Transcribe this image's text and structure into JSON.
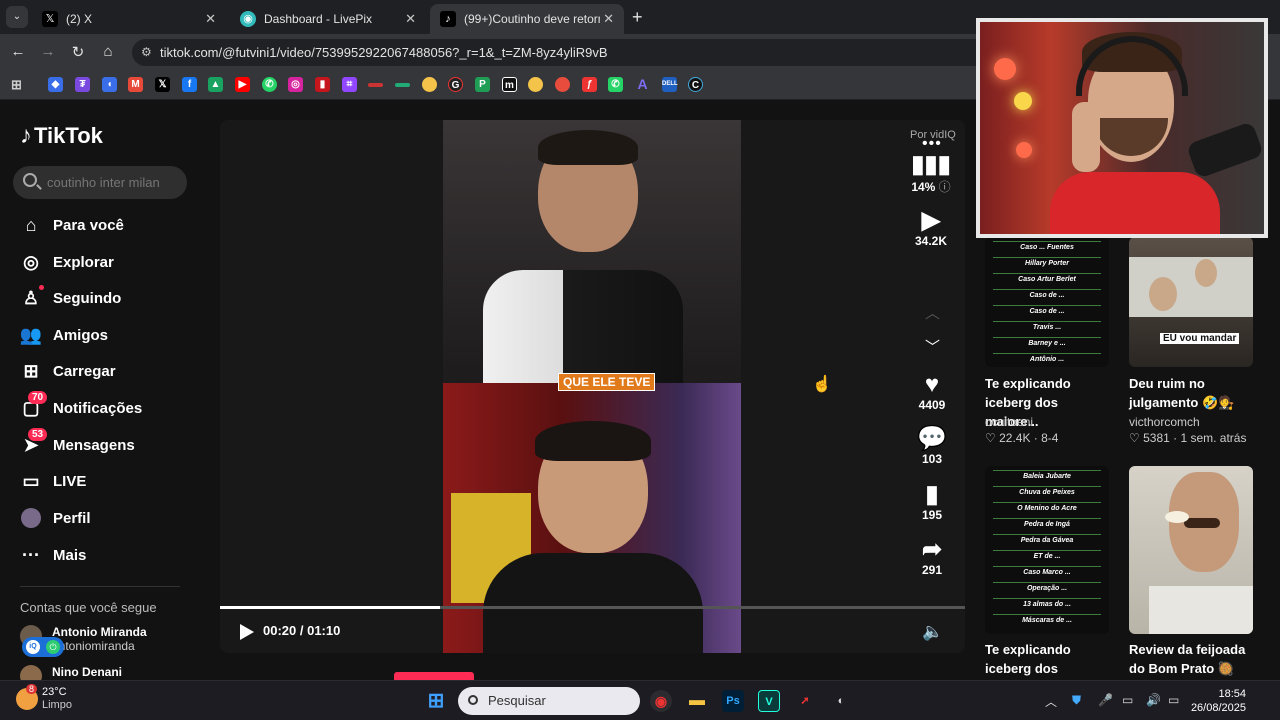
{
  "browser": {
    "tabs": [
      {
        "title": "(2) X",
        "icon": "x-icon",
        "active": false
      },
      {
        "title": "Dashboard - LivePix",
        "icon": "livepix-icon",
        "active": false
      },
      {
        "title": "(99+)Coutinho deve retornar à",
        "icon": "tiktok-icon",
        "active": true
      }
    ],
    "url": "tiktok.com/@futvini1/video/7539952922067488056?_r=1&_t=ZM-8yz4yliR9vB"
  },
  "tiktok": {
    "logo": "TikTok",
    "search_placeholder": "coutinho inter milan",
    "nav": [
      {
        "label": "Para você",
        "icon": "home-icon"
      },
      {
        "label": "Explorar",
        "icon": "compass-icon"
      },
      {
        "label": "Seguindo",
        "icon": "following-icon"
      },
      {
        "label": "Amigos",
        "icon": "friends-icon"
      },
      {
        "label": "Carregar",
        "icon": "upload-icon"
      },
      {
        "label": "Notificações",
        "icon": "inbox-icon",
        "badge": "70"
      },
      {
        "label": "Mensagens",
        "icon": "messages-icon",
        "badge": "53"
      },
      {
        "label": "LIVE",
        "icon": "live-icon"
      },
      {
        "label": "Perfil",
        "icon": "profile-avatar"
      },
      {
        "label": "Mais",
        "icon": "more-icon"
      }
    ],
    "following_title": "Contas que você segue",
    "following": [
      {
        "name": "Antonio Miranda",
        "username": "antoniomiranda"
      },
      {
        "name": "Nino Denani",
        "username": ""
      }
    ]
  },
  "player": {
    "by": "Por vidIQ",
    "caption": "QUE ELE TEVE",
    "progress_fraction": 0.295,
    "time": "00:20 / 01:10",
    "stats_percent": "14%",
    "views": "34.2K",
    "likes": "4409",
    "comments": "103",
    "saves": "195",
    "shares": "291",
    "author": "futvini1"
  },
  "recommendations": [
    {
      "title": "Te explicando iceberg dos maiore...",
      "author": "ocultoeni",
      "stats": "♡ 22.4K · 8-4",
      "overlay": [
        "Caso ... Fuentes",
        "Hillary Porter",
        "Caso Artur Berlet",
        "Caso de ...",
        "Caso de ...",
        "Travis ...",
        "Barney e ...",
        "Antônio ..."
      ]
    },
    {
      "title": "Deu ruim no julgamento 🤣🧑‍⚖️",
      "author": "victhorcomch",
      "stats": "♡ 5381 · 1 sem. atrás",
      "overlay_text": "EU vou mandar"
    },
    {
      "title": "Te explicando iceberg dos maiore...",
      "author": "",
      "stats": "",
      "overlay": [
        "Baleia Jubarte",
        "Chuva de Peixes",
        "O Menino do Acre",
        "Pedra de Ingá",
        "Pedra da Gávea",
        "ET de ...",
        "Caso Marco ...",
        "Operação ...",
        "13 almas do ...",
        "Máscaras de ..."
      ]
    },
    {
      "title": "Review da feijoada do Bom Prato 🥘",
      "author": "",
      "stats": ""
    }
  ],
  "taskbar": {
    "weather_temp": "23°C",
    "weather_desc": "Limpo",
    "weather_badge": "8",
    "search_placeholder": "Pesquisar",
    "time": "18:54",
    "date": "26/08/2025"
  }
}
